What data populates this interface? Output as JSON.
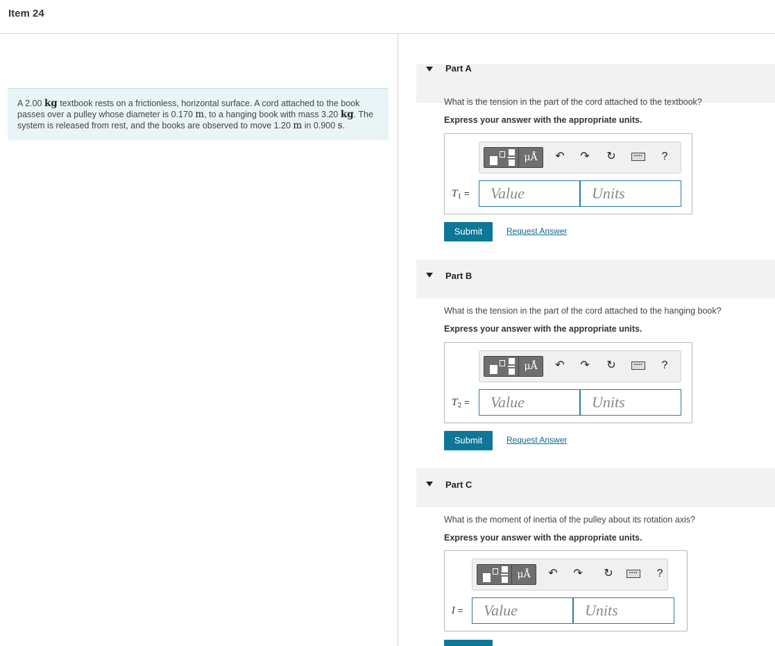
{
  "header": {
    "title": "Item 24"
  },
  "problem": {
    "t1": "A 2.00 ",
    "u1": "kg",
    "t2": " textbook rests on a frictionless, horizontal surface. A cord attached to the book passes over a pulley whose diameter is 0.170 ",
    "u2": "m",
    "t3": ", to a hanging book with mass 3.20 ",
    "u3": "kg",
    "t4": ". The system is released from rest, and the books are observed to move 1.20 ",
    "u4": "m",
    "t5": " in 0.900 ",
    "u5": "s",
    "t6": "."
  },
  "toolbar": {
    "units_symbol": "μÅ",
    "undo_icon": "↶",
    "redo_icon": "↷",
    "reset_icon": "↻",
    "keyboard_icon": "▪▪▪▪",
    "help_symbol": "?"
  },
  "inputs": {
    "value_placeholder": "Value",
    "units_placeholder": "Units"
  },
  "buttons": {
    "submit": "Submit",
    "request_answer": "Request Answer"
  },
  "parts": [
    {
      "label": "Part A",
      "question": "What is the tension in the part of the cord attached to the textbook?",
      "instruction": "Express your answer with the appropriate units.",
      "var": "T",
      "sub": "1",
      "eq": " ="
    },
    {
      "label": "Part B",
      "question": "What is the tension in the part of the cord attached to the hanging book?",
      "instruction": "Express your answer with the appropriate units.",
      "var": "T",
      "sub": "2",
      "eq": " ="
    },
    {
      "label": "Part C",
      "question": "What is the moment of inertia of the pulley about its rotation axis?",
      "instruction": "Express your answer with the appropriate units.",
      "var": "I",
      "sub": "",
      "eq": " ="
    }
  ]
}
